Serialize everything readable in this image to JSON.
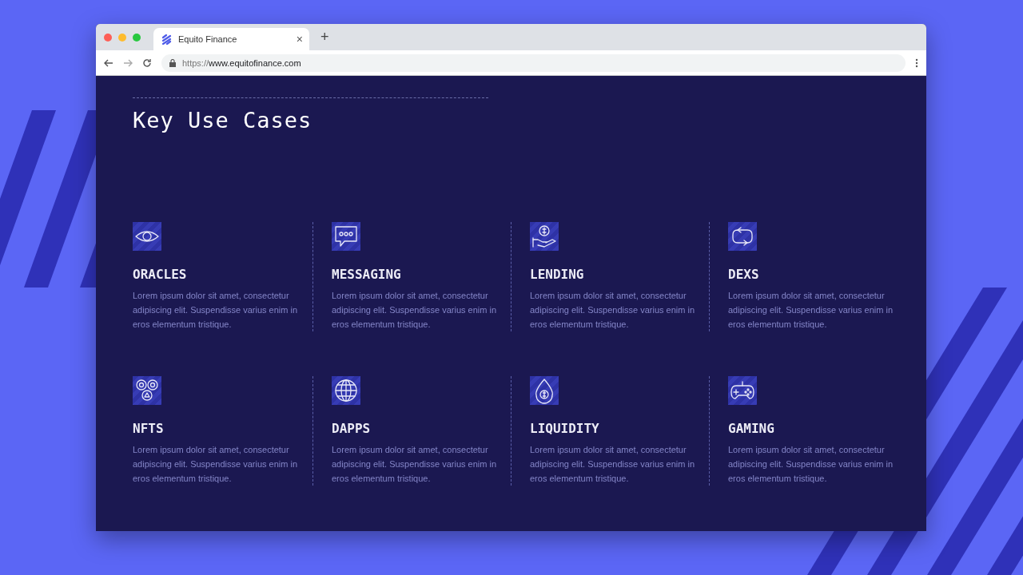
{
  "browser": {
    "tab_title": "Equito Finance",
    "tab_close": "×",
    "new_tab": "+",
    "url_scheme": "https://",
    "url_host": "www.equitofinance.com"
  },
  "section": {
    "title": "Key Use Cases"
  },
  "use_cases": [
    {
      "kind": "eye",
      "title": "ORACLES",
      "text": "Lorem ipsum dolor sit amet, consectetur adipiscing elit. Suspendisse varius enim in eros elementum tristique."
    },
    {
      "kind": "chat",
      "title": "MESSAGING",
      "text": "Lorem ipsum dolor sit amet, consectetur adipiscing elit. Suspendisse varius enim in eros elementum tristique."
    },
    {
      "kind": "hand-coin",
      "title": "LENDING",
      "text": "Lorem ipsum dolor sit amet, consectetur adipiscing elit. Suspendisse varius enim in eros elementum tristique."
    },
    {
      "kind": "cycle",
      "title": "DEXS",
      "text": "Lorem ipsum dolor sit amet, consectetur adipiscing elit. Suspendisse varius enim in eros elementum tristique."
    },
    {
      "kind": "tokens",
      "title": "NFTS",
      "text": "Lorem ipsum dolor sit amet, consectetur adipiscing elit. Suspendisse varius enim in eros elementum tristique."
    },
    {
      "kind": "globe",
      "title": "DAPPS",
      "text": "Lorem ipsum dolor sit amet, consectetur adipiscing elit. Suspendisse varius enim in eros elementum tristique."
    },
    {
      "kind": "drop",
      "title": "LIQUIDITY",
      "text": "Lorem ipsum dolor sit amet, consectetur adipiscing elit. Suspendisse varius enim in eros elementum tristique."
    },
    {
      "kind": "gamepad",
      "title": "GAMING",
      "text": "Lorem ipsum dolor sit amet, consectetur adipiscing elit. Suspendisse varius enim in eros elementum tristique."
    }
  ]
}
